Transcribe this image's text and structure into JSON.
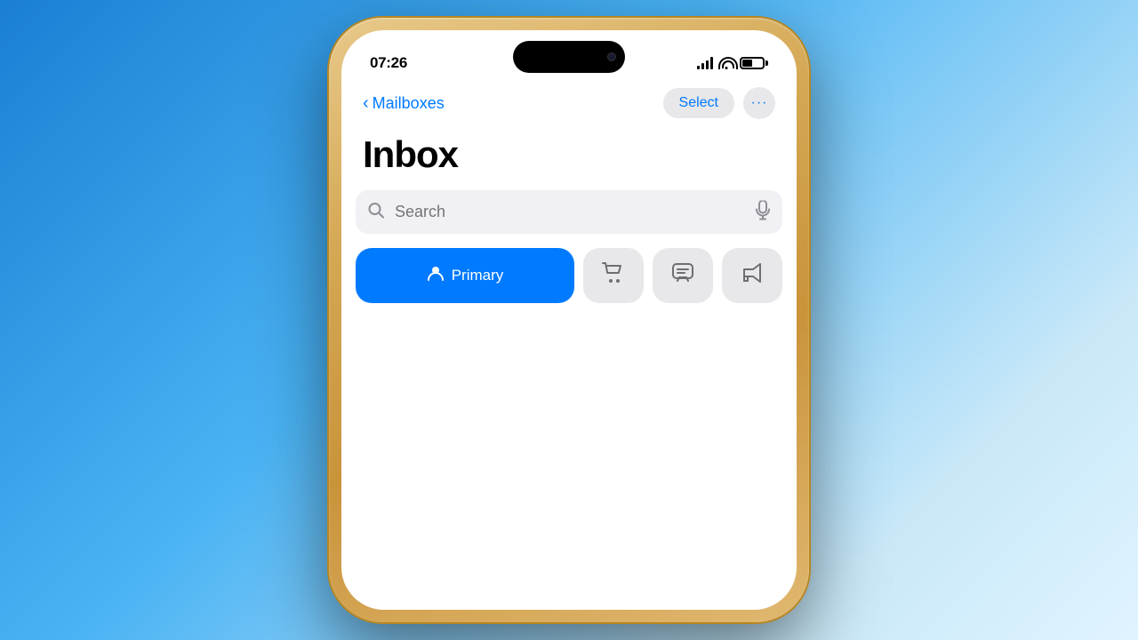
{
  "background": {
    "gradient_start": "#1a7fd4",
    "gradient_end": "#c8e8f8"
  },
  "status_bar": {
    "time": "07:26",
    "signal_label": "signal-bars",
    "wifi_label": "wifi-icon",
    "battery_label": "battery-icon"
  },
  "navigation": {
    "back_label": "Mailboxes",
    "select_label": "Select",
    "more_label": "···"
  },
  "page": {
    "title": "Inbox"
  },
  "search": {
    "placeholder": "Search"
  },
  "filter_tabs": [
    {
      "id": "primary",
      "label": "Primary",
      "icon": "person",
      "active": true
    },
    {
      "id": "transactions",
      "label": "Transactions",
      "icon": "cart",
      "active": false
    },
    {
      "id": "updates",
      "label": "Updates",
      "icon": "message",
      "active": false
    },
    {
      "id": "promotions",
      "label": "Promotions",
      "icon": "megaphone",
      "active": false
    }
  ]
}
